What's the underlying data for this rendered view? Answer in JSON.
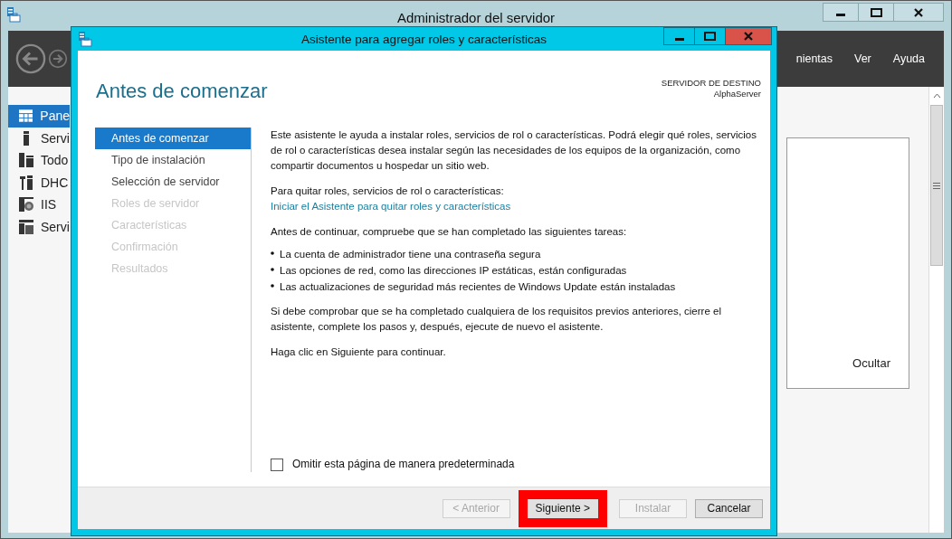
{
  "window": {
    "title": "Administrador del servidor"
  },
  "toolbar": {
    "menu": [
      "nientas",
      "Ver",
      "Ayuda"
    ]
  },
  "sidebar": {
    "items": [
      {
        "label": "Pane",
        "selected": true,
        "kind": "grid"
      },
      {
        "label": "Servi",
        "selected": false,
        "kind": "server"
      },
      {
        "label": "Todo",
        "selected": false,
        "kind": "servers"
      },
      {
        "label": "DHC",
        "selected": false,
        "kind": "tools"
      },
      {
        "label": "IIS",
        "selected": false,
        "kind": "globe"
      },
      {
        "label": "Servi",
        "selected": false,
        "kind": "files"
      }
    ]
  },
  "panel": {
    "hide_link": "Ocultar"
  },
  "wizard": {
    "title": "Asistente para agregar roles y características",
    "heading": "Antes de comenzar",
    "destination_label": "SERVIDOR DE DESTINO",
    "destination_server": "AlphaServer",
    "steps": [
      {
        "label": "Antes de comenzar",
        "selected": true,
        "disabled": false
      },
      {
        "label": "Tipo de instalación",
        "selected": false,
        "disabled": false
      },
      {
        "label": "Selección de servidor",
        "selected": false,
        "disabled": false
      },
      {
        "label": "Roles de servidor",
        "selected": false,
        "disabled": true
      },
      {
        "label": "Características",
        "selected": false,
        "disabled": true
      },
      {
        "label": "Confirmación",
        "selected": false,
        "disabled": true
      },
      {
        "label": "Resultados",
        "selected": false,
        "disabled": true
      }
    ],
    "intro": "Este asistente le ayuda a instalar roles, servicios de rol o características. Podrá elegir qué roles, servicios de rol o características desea instalar según las necesidades de los equipos de la organización, como compartir documentos u hospedar un sitio web.",
    "remove_label": "Para quitar roles, servicios de rol o características:",
    "remove_link": "Iniciar el Asistente para quitar roles y características",
    "before_label": "Antes de continuar, compruebe que se han completado las siguientes tareas:",
    "tasks": [
      "La cuenta de administrador tiene una contraseña segura",
      "Las opciones de red, como las direcciones IP estáticas, están configuradas",
      "Las actualizaciones de seguridad más recientes de Windows Update están instaladas"
    ],
    "note": "Si debe comprobar que se ha completado cualquiera de los requisitos previos anteriores, cierre el asistente, complete los pasos y, después, ejecute de nuevo el asistente.",
    "continue_text": "Haga clic en Siguiente para continuar.",
    "skip_checkbox": {
      "label": "Omitir esta página de manera predeterminada",
      "checked": false
    },
    "buttons": [
      {
        "label": "< Anterior",
        "disabled": true,
        "highlighted": false
      },
      {
        "label": "Siguiente >",
        "disabled": false,
        "highlighted": true
      },
      {
        "label": "Instalar",
        "disabled": true,
        "highlighted": false
      },
      {
        "label": "Cancelar",
        "disabled": false,
        "highlighted": false
      }
    ]
  }
}
